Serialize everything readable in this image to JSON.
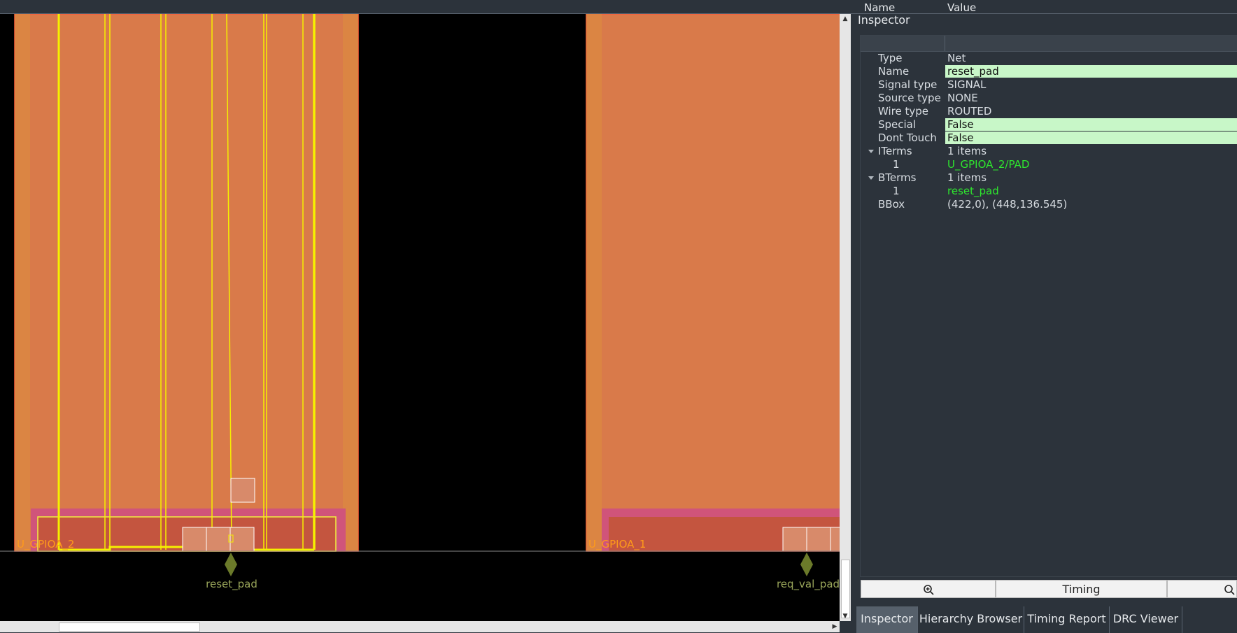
{
  "layout_view": {
    "instances": [
      {
        "label": "U_GPIOA_2"
      },
      {
        "label": "U_GPIOA_1"
      }
    ],
    "pins": [
      {
        "label": "reset_pad"
      },
      {
        "label": "req_val_pad"
      }
    ]
  },
  "inspector": {
    "title": "Inspector",
    "columns": {
      "name": "Name",
      "value": "Value"
    },
    "rows": [
      {
        "name": "Type",
        "value": "Net"
      },
      {
        "name": "Name",
        "value": "reset_pad"
      },
      {
        "name": "Signal type",
        "value": "SIGNAL"
      },
      {
        "name": "Source type",
        "value": "NONE"
      },
      {
        "name": "Wire type",
        "value": "ROUTED"
      },
      {
        "name": "Special",
        "value": "False"
      },
      {
        "name": "Dont Touch",
        "value": "False"
      },
      {
        "name": "ITerms",
        "value": "1 items"
      },
      {
        "name": "1",
        "value": "U_GPIOA_2/PAD"
      },
      {
        "name": "BTerms",
        "value": "1 items"
      },
      {
        "name": "1",
        "value": "reset_pad"
      },
      {
        "name": "BBox",
        "value": "(422,0), (448,136.545)"
      }
    ],
    "buttons": {
      "zoom_left": "zoom-in-icon",
      "timing": "Timing",
      "zoom_right": "zoom-in-icon"
    }
  },
  "tabs": [
    "Inspector",
    "Hierarchy Browser",
    "Timing Report",
    "DRC Viewer"
  ],
  "colors": {
    "cell_fill": "#d97a4a",
    "pad_fill": "#c4553f",
    "highlight": "#ffff00",
    "editable_bg": "#c8f7c8",
    "link_text": "#2ee62e"
  }
}
